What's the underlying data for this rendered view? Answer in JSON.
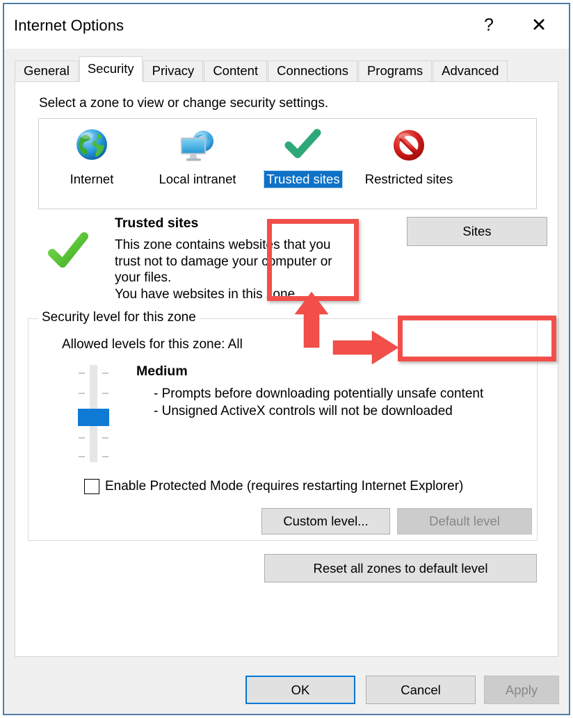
{
  "window": {
    "title": "Internet Options",
    "help_icon": "?",
    "close_icon": "✕"
  },
  "tabs": [
    {
      "label": "General",
      "active": false
    },
    {
      "label": "Security",
      "active": true
    },
    {
      "label": "Privacy",
      "active": false
    },
    {
      "label": "Content",
      "active": false
    },
    {
      "label": "Connections",
      "active": false
    },
    {
      "label": "Programs",
      "active": false
    },
    {
      "label": "Advanced",
      "active": false
    }
  ],
  "security": {
    "instruction": "Select a zone to view or change security settings.",
    "zones": [
      {
        "label": "Internet",
        "icon": "globe-icon",
        "selected": false
      },
      {
        "label": "Local intranet",
        "icon": "monitor-globe-icon",
        "selected": false
      },
      {
        "label": "Trusted sites",
        "icon": "green-check-icon",
        "selected": true
      },
      {
        "label": "Restricted sites",
        "icon": "red-prohibited-icon",
        "selected": false
      }
    ],
    "zone_detail": {
      "icon": "green-check-icon",
      "title": "Trusted sites",
      "description": "This zone contains websites that you trust not to damage your computer or your files.",
      "extra": "You have websites in this zone."
    },
    "sites_button": "Sites",
    "level_group": {
      "title": "Security level for this zone",
      "allowed_levels": "Allowed levels for this zone: All",
      "level_name": "Medium",
      "bullets": [
        "- Prompts before downloading potentially unsafe content",
        "- Unsigned ActiveX controls will not be downloaded"
      ],
      "protected_mode": {
        "label": "Enable Protected Mode (requires restarting Internet Explorer)",
        "checked": false
      },
      "custom_level_button": "Custom level...",
      "default_level_button": "Default level",
      "default_level_disabled": true
    },
    "reset_button": "Reset all zones to default level"
  },
  "footer": {
    "ok": "OK",
    "cancel": "Cancel",
    "apply": "Apply",
    "apply_disabled": true
  },
  "annotations": {
    "highlight_trusted_sites": "red-rectangle-highlight",
    "highlight_sites_button": "red-rectangle-highlight",
    "arrow_up": "red-arrow-up",
    "arrow_right": "red-arrow-right"
  },
  "colors": {
    "window_border": "#4f7da8",
    "accent_blue": "#0078d7",
    "selection_blue": "#0f72c6",
    "annotation_red": "#f24f4a",
    "green_check": "#5cc63c",
    "teal_check": "#2ea879"
  }
}
